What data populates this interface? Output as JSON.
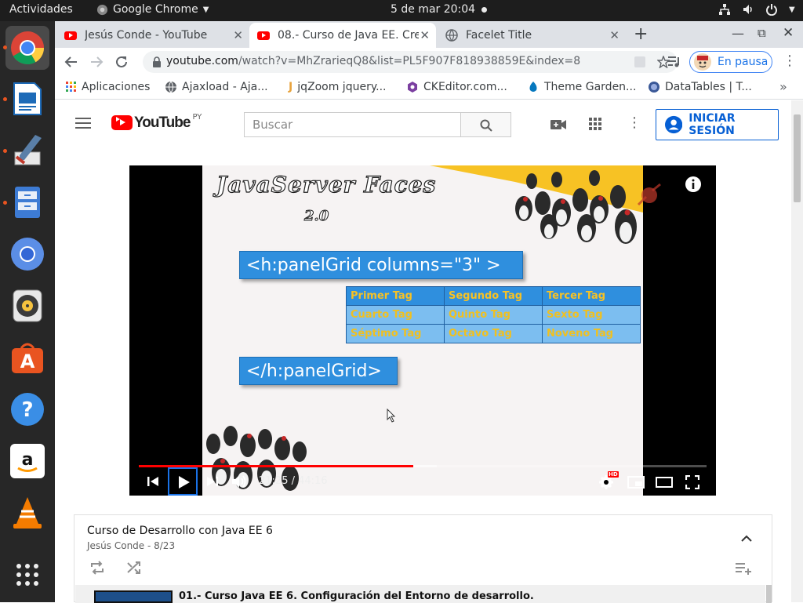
{
  "topbar": {
    "activities": "Actividades",
    "app_name": "Google Chrome",
    "datetime": "5 de mar  20:04"
  },
  "dock": {
    "apps": [
      "chrome-icon",
      "writer-icon",
      "editor-icon",
      "files-icon",
      "chromium-icon",
      "rhythmbox-icon",
      "software-center-icon",
      "help-icon",
      "amazon-icon",
      "vlc-icon",
      "app-grid-icon"
    ]
  },
  "tabs": [
    {
      "title": "Jesús Conde - YouTube",
      "favicon": "youtube-icon"
    },
    {
      "title": "08.- Curso de Java EE. Cre",
      "favicon": "youtube-icon"
    },
    {
      "title": "Facelet Title",
      "favicon": "globe-icon"
    }
  ],
  "omnibox": {
    "domain": "youtube.com",
    "path": "/watch?v=MhZrarieqQ8&list=PL5F907F818938859E&index=8"
  },
  "profile": {
    "label": "En pausa"
  },
  "bookmarks": [
    {
      "label": "Aplicaciones",
      "icon": "apps-grid-icon"
    },
    {
      "label": "Ajaxload - Aja...",
      "icon": "globe-icon"
    },
    {
      "label": "jqZoom jquery...",
      "icon": "jq-icon"
    },
    {
      "label": "CKEditor.com...",
      "icon": "ckeditor-icon"
    },
    {
      "label": "Theme Garden...",
      "icon": "drupal-icon"
    },
    {
      "label": "DataTables | T...",
      "icon": "datatables-icon"
    }
  ],
  "youtube": {
    "logo_text": "YouTube",
    "logo_region": "PY",
    "search_placeholder": "Buscar",
    "signin_label": "INICIAR SESIÓN"
  },
  "slide": {
    "title": "JavaServer Faces",
    "version": "2.0",
    "open_tag": "<h:panelGrid columns=\"3\" >",
    "close_tag": "</h:panelGrid>",
    "table_header": [
      "Primer Tag",
      "Segundo Tag",
      "Tercer Tag"
    ],
    "table_rows": [
      [
        "Cuarto Tag",
        "Quinto Tag",
        "Sexto Tag"
      ],
      [
        "Séptimo Tag",
        "Octavo Tag",
        "Noveno Tag"
      ]
    ]
  },
  "player": {
    "time": "21:25 / 44:16",
    "progress": 0.484,
    "buffered": 0.525
  },
  "playlist": {
    "title": "Curso de Desarrollo con Java EE 6",
    "subtitle": "Jesús Conde - 8/23",
    "first_item": "01.- Curso Java EE 6. Configuración del Entorno de desarrollo."
  }
}
